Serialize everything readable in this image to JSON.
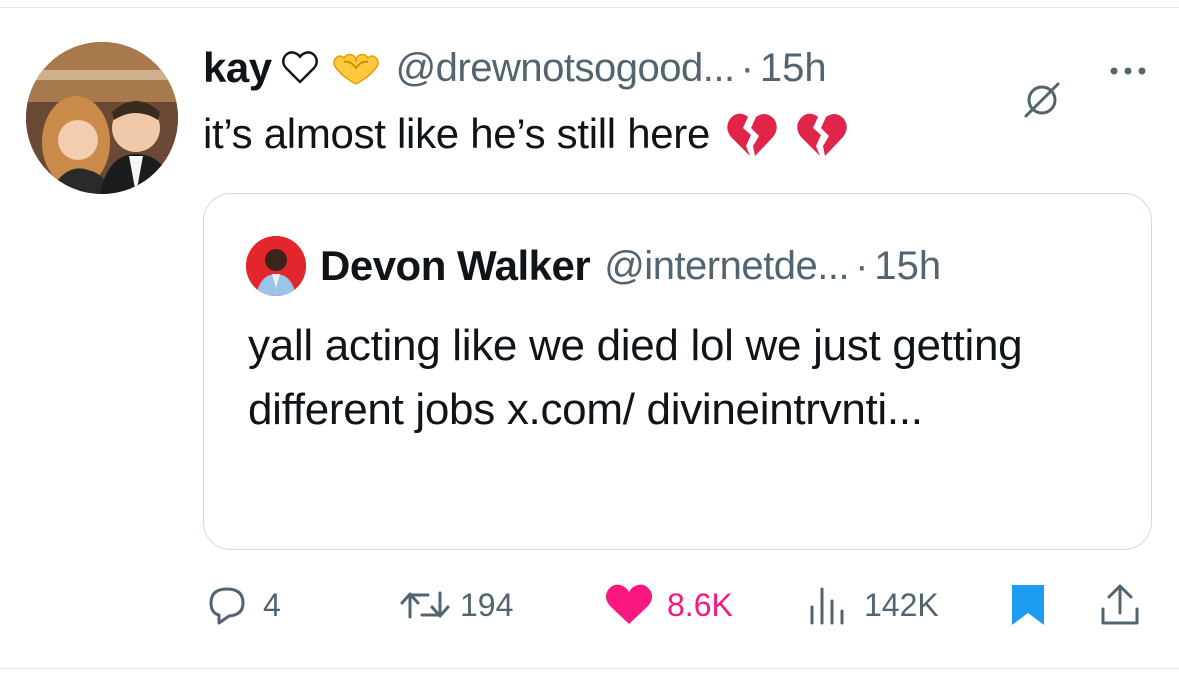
{
  "tweet": {
    "author_name": "kay",
    "handle": "@drewnotsogood...",
    "separator": "·",
    "time": "15h",
    "text": "it’s almost like he’s still here"
  },
  "quote": {
    "author_name": "Devon Walker",
    "handle": "@internetde...",
    "separator": "·",
    "time": "15h",
    "text": "yall acting like we died lol we just getting different jobs x.com/ divineintrvnti..."
  },
  "actions": {
    "replies": "4",
    "reposts": "194",
    "likes": "8.6K",
    "views": "142K"
  },
  "icons": {
    "header": [
      "white-heart-icon",
      "heart-hands-icon",
      "grok-icon",
      "more-icon"
    ],
    "text": [
      "broken-heart-icon",
      "broken-heart-icon"
    ],
    "actions": [
      "reply-icon",
      "repost-icon",
      "like-icon",
      "views-icon",
      "bookmark-icon",
      "share-icon"
    ]
  },
  "colors": {
    "text": "#0f1419",
    "secondary": "#536471",
    "like": "#f91880",
    "bookmark": "#1d9bf0",
    "border": "#cfd9de"
  }
}
